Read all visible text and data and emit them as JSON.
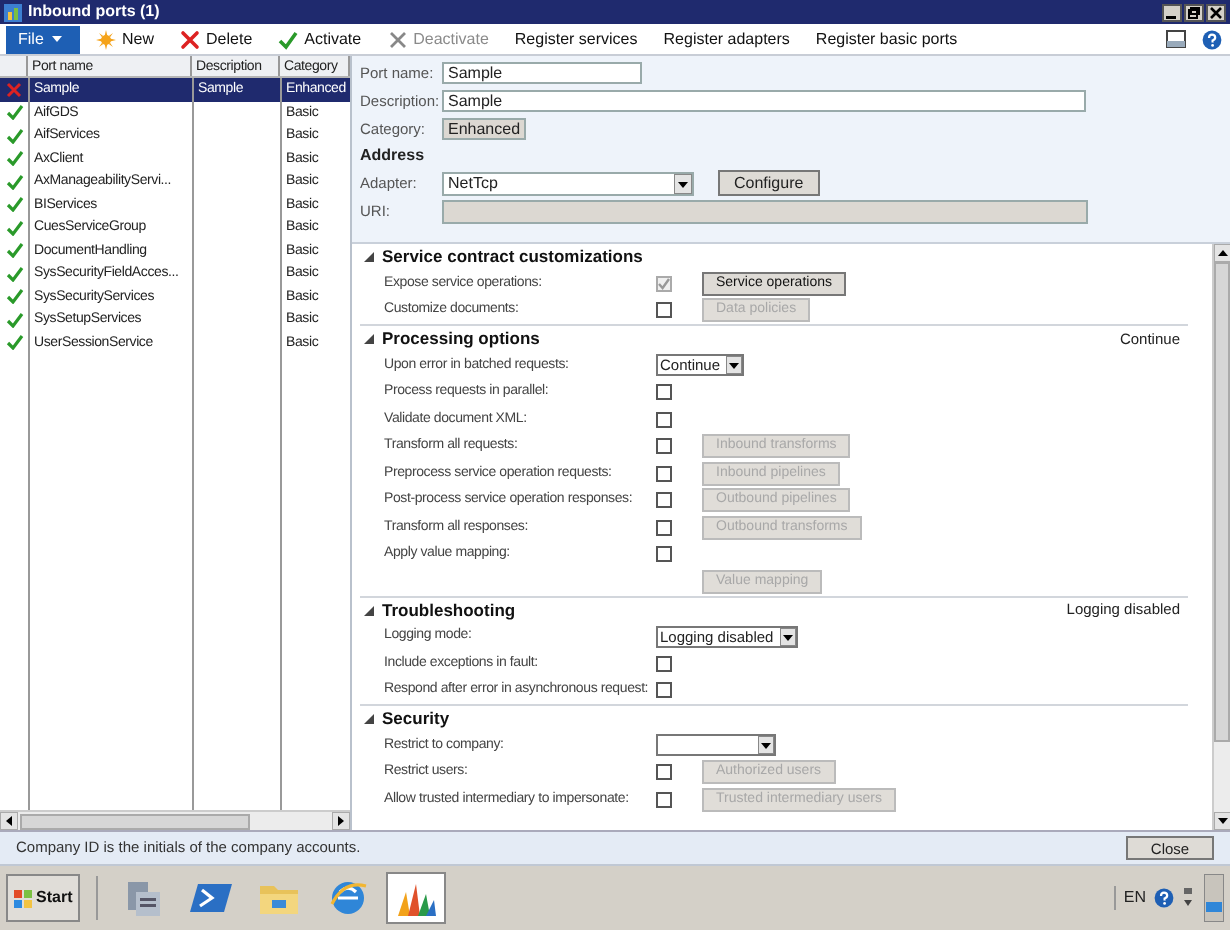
{
  "window": {
    "title": "Inbound ports (1)"
  },
  "toolbar": {
    "file_menu": "File",
    "buttons": [
      {
        "label": "New",
        "kind": "new",
        "disabled": false
      },
      {
        "label": "Delete",
        "kind": "delete",
        "disabled": false
      },
      {
        "label": "Activate",
        "kind": "activate",
        "disabled": false
      },
      {
        "label": "Deactivate",
        "kind": "deactivate",
        "disabled": true
      },
      {
        "label": "Register services",
        "disabled": false
      },
      {
        "label": "Register adapters",
        "disabled": false
      },
      {
        "label": "Register basic ports",
        "disabled": false
      }
    ]
  },
  "grid": {
    "columns": [
      "Port name",
      "Description",
      "Category"
    ],
    "rows": [
      {
        "kind": "error",
        "port_name": "Sample",
        "description": "Sample",
        "category": "Enhanced",
        "selected": true
      },
      {
        "kind": "ok",
        "port_name": "AifGDS",
        "category": "Basic",
        "selected": false
      },
      {
        "kind": "ok",
        "port_name": "AifServices",
        "category": "Basic",
        "selected": false
      },
      {
        "kind": "ok",
        "port_name": "AxClient",
        "category": "Basic",
        "selected": false
      },
      {
        "kind": "ok",
        "port_name": "AxManageabilityServi...",
        "category": "Basic",
        "selected": false
      },
      {
        "kind": "ok",
        "port_name": "BIServices",
        "category": "Basic",
        "selected": false
      },
      {
        "kind": "ok",
        "port_name": "CuesServiceGroup",
        "category": "Basic",
        "selected": false
      },
      {
        "kind": "ok",
        "port_name": "DocumentHandling",
        "category": "Basic",
        "selected": false
      },
      {
        "kind": "ok",
        "port_name": "SysSecurityFieldAcces...",
        "category": "Basic",
        "selected": false
      },
      {
        "kind": "ok",
        "port_name": "SysSecurityServices",
        "category": "Basic",
        "selected": false
      },
      {
        "kind": "ok",
        "port_name": "SysSetupServices",
        "category": "Basic",
        "selected": false
      },
      {
        "kind": "ok",
        "port_name": "UserSessionService",
        "category": "Basic",
        "selected": false
      }
    ]
  },
  "form": {
    "port_name": {
      "label": "Port name:",
      "value": "Sample"
    },
    "description": {
      "label": "Description:",
      "value": "Sample"
    },
    "category": {
      "label": "Category:",
      "value": "Enhanced"
    },
    "address_heading": "Address",
    "adapter": {
      "label": "Adapter:",
      "value": "NetTcp"
    },
    "configure_button": "Configure",
    "uri": {
      "label": "URI:"
    }
  },
  "sections": [
    {
      "title": "Service contract customizations",
      "expanded": true,
      "rows": [
        {
          "kind": "checkbox",
          "label": "Expose service operations:",
          "checked": true,
          "disabled": true,
          "button": {
            "label": "Service operations",
            "disabled": false
          }
        },
        {
          "kind": "checkbox",
          "label": "Customize documents:",
          "checked": false,
          "disabled": false,
          "button": {
            "label": "Data policies",
            "disabled": true
          }
        }
      ]
    },
    {
      "title": "Processing options",
      "summary": "Continue",
      "expanded": true,
      "rows": [
        {
          "kind": "select",
          "label": "Upon error in batched requests:",
          "value": "Continue"
        },
        {
          "kind": "checkbox",
          "label": "Process requests in parallel:",
          "checked": false,
          "disabled": false
        },
        {
          "kind": "checkbox",
          "label": "Validate document XML:",
          "checked": false,
          "disabled": false
        },
        {
          "kind": "checkbox",
          "label": "Transform all requests:",
          "checked": false,
          "disabled": false,
          "button": {
            "label": "Inbound transforms",
            "disabled": true
          }
        },
        {
          "kind": "checkbox",
          "label": "Preprocess service operation requests:",
          "checked": false,
          "disabled": false,
          "button": {
            "label": "Inbound pipelines",
            "disabled": true
          }
        },
        {
          "kind": "checkbox",
          "label": "Post-process service operation responses:",
          "checked": false,
          "disabled": false,
          "button": {
            "label": "Outbound pipelines",
            "disabled": true
          }
        },
        {
          "kind": "checkbox",
          "label": "Transform all responses:",
          "checked": false,
          "disabled": false,
          "button": {
            "label": "Outbound transforms",
            "disabled": true
          }
        },
        {
          "kind": "checkbox",
          "label": "Apply value mapping:",
          "checked": false,
          "disabled": false
        },
        {
          "kind": "button",
          "button": {
            "label": "Value mapping",
            "disabled": true
          }
        }
      ]
    },
    {
      "title": "Troubleshooting",
      "summary": "Logging disabled",
      "expanded": true,
      "rows": [
        {
          "kind": "select",
          "label": "Logging mode:",
          "value": "Logging disabled"
        },
        {
          "kind": "checkbox",
          "label": "Include exceptions in fault:",
          "checked": false,
          "disabled": false
        },
        {
          "kind": "checkbox",
          "label": "Respond after error in asynchronous request:",
          "checked": false,
          "disabled": false
        }
      ]
    },
    {
      "title": "Security",
      "expanded": true,
      "rows": [
        {
          "kind": "select",
          "label": "Restrict to company:"
        },
        {
          "kind": "checkbox",
          "label": "Restrict users:",
          "checked": false,
          "disabled": false,
          "button": {
            "label": "Authorized users",
            "disabled": true
          }
        },
        {
          "kind": "checkbox",
          "label": "Allow trusted intermediary to impersonate:",
          "checked": false,
          "disabled": false,
          "button": {
            "label": "Trusted intermediary users",
            "disabled": true
          }
        }
      ]
    }
  ],
  "status_bar": {
    "text": "Company ID is the initials of the company accounts.",
    "close_button": "Close"
  },
  "taskbar": {
    "start": "Start",
    "apps": [
      {
        "kind": "server",
        "selected": false
      },
      {
        "kind": "powershell",
        "selected": false
      },
      {
        "kind": "folder",
        "selected": false
      },
      {
        "kind": "browser",
        "selected": false
      },
      {
        "kind": "chart",
        "selected": true
      }
    ],
    "language": "EN"
  }
}
